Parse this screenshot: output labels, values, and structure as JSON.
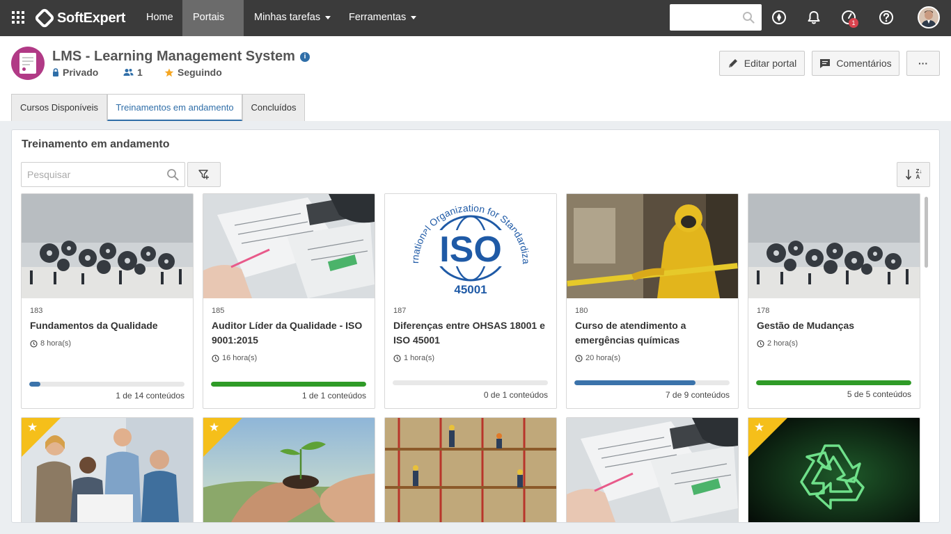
{
  "navbar": {
    "logo": "SoftExpert",
    "items": [
      {
        "label": "Home"
      },
      {
        "label": "Portais"
      },
      {
        "label": "Minhas tarefas"
      },
      {
        "label": "Ferramentas"
      }
    ],
    "notification_badge": "1"
  },
  "portal": {
    "title": "LMS - Learning Management System",
    "info_glyph": "i",
    "privacy": "Privado",
    "members": "1",
    "follow": "Seguindo",
    "buttons": {
      "edit": "Editar portal",
      "comments": "Comentários",
      "more": "···"
    }
  },
  "tabs": [
    {
      "label": "Cursos Disponíveis"
    },
    {
      "label": "Treinamentos em andamento"
    },
    {
      "label": "Concluídos"
    }
  ],
  "panel": {
    "title": "Treinamento em andamento",
    "search_placeholder": "Pesquisar",
    "sort_glyph": "Z↓A"
  },
  "colors": {
    "navbar": "#3b3b3b",
    "accent": "#2f6ea8",
    "progress_green": "#2f9b27",
    "progress_blue": "#3b73ab",
    "star": "#f5bf1a",
    "portal_icon": "#b13a86"
  },
  "courses": [
    {
      "code": "183",
      "name": "Fundamentos da Qualidade",
      "duration": "8 hora(s)",
      "progress": 0.07,
      "progress_color": "#3b73ab",
      "count": "1 de 14 conteúdos",
      "image": "gears-people"
    },
    {
      "code": "185",
      "name": "Auditor Líder da Qualidade - ISO 9001:2015",
      "duration": "16 hora(s)",
      "progress": 1.0,
      "progress_color": "#2f9b27",
      "count": "1 de 1 conteúdos",
      "image": "documents-desk"
    },
    {
      "code": "187",
      "name": "Diferenças entre OHSAS 18001 e ISO 45001",
      "duration": "1 hora(s)",
      "progress": 0.0,
      "progress_color": "#3b73ab",
      "count": "0 de 1 conteúdos",
      "image": "iso-logo",
      "iso": {
        "arc": "International Organization for Standardization",
        "mark": "ISO",
        "number": "45001"
      }
    },
    {
      "code": "180",
      "name": "Curso de atendimento a emergências químicas",
      "duration": "20 hora(s)",
      "progress": 0.78,
      "progress_color": "#3b73ab",
      "count": "7 de 9 conteúdos",
      "image": "hazmat-suit"
    },
    {
      "code": "178",
      "name": "Gestão de Mudanças",
      "duration": "2 hora(s)",
      "progress": 1.0,
      "progress_color": "#2f9b27",
      "count": "5 de 5 conteúdos",
      "image": "gears-people"
    }
  ],
  "courses_row2": [
    {
      "image": "team-meeting",
      "starred": true
    },
    {
      "image": "plant-in-hands",
      "starred": true
    },
    {
      "image": "scaffolding-workers",
      "starred": false
    },
    {
      "image": "documents-desk",
      "starred": false
    },
    {
      "image": "recycle-symbol",
      "starred": true
    }
  ]
}
